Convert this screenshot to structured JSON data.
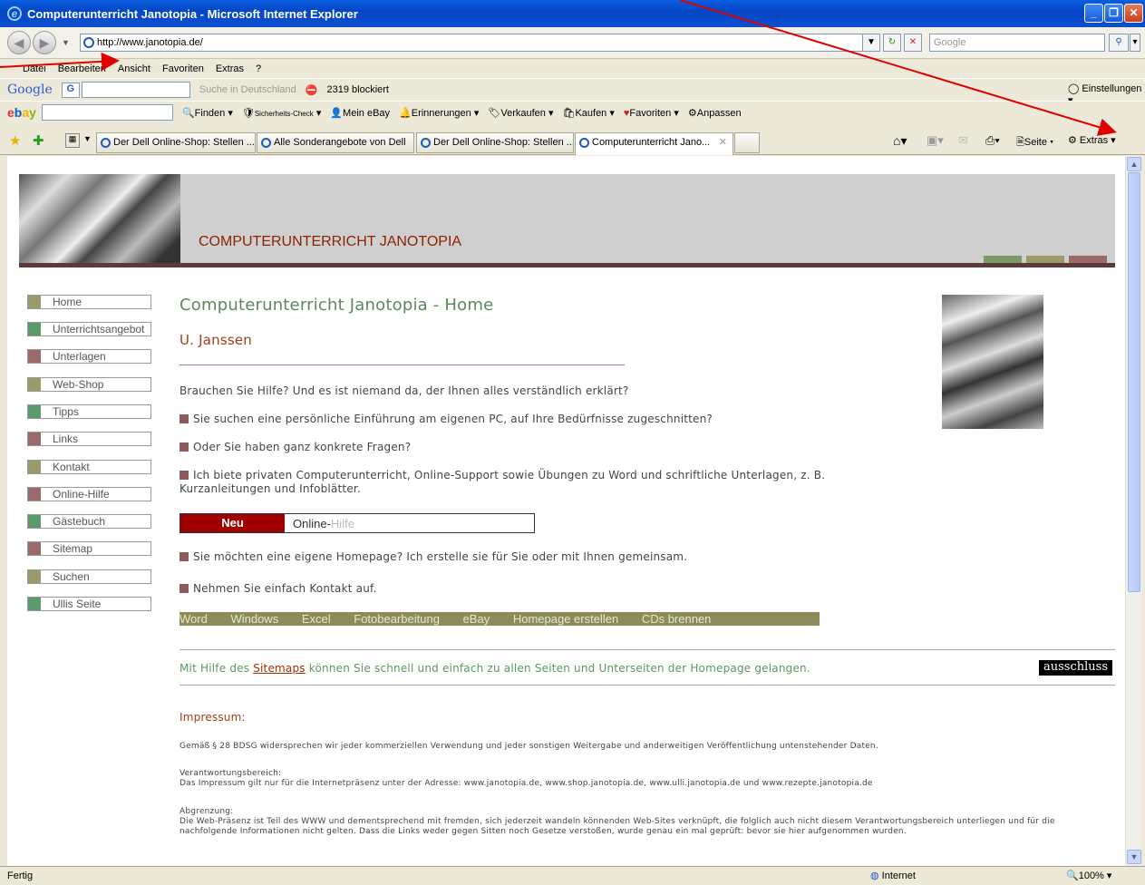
{
  "window": {
    "title": "Computerunterricht Janotopia - Microsoft Internet Explorer"
  },
  "address": {
    "url": "http://www.janotopia.de/",
    "search_placeholder": "Google"
  },
  "menu": [
    "Datei",
    "Bearbeiten",
    "Ansicht",
    "Favoriten",
    "Extras",
    "?"
  ],
  "google_toolbar": {
    "brand": "Google",
    "search_hint": "Suche in Deutschland",
    "blocked": "2319 blockiert",
    "settings": "Einstellungen"
  },
  "ebay_toolbar": {
    "items": [
      "Finden",
      "Sicherheits-Check",
      "Mein eBay",
      "Erinnerungen",
      "Verkaufen",
      "Kaufen",
      "Favoriten",
      "Anpassen"
    ]
  },
  "tabs": [
    "Der Dell Online-Shop: Stellen ...",
    "Alle Sonderangebote von Dell",
    "Der Dell Online-Shop: Stellen ...",
    "Computerunterricht Jano..."
  ],
  "command_bar": {
    "page": "Seite",
    "tools": "Extras"
  },
  "page": {
    "header_title": "COMPUTERUNTERRICHT JANOTOPIA",
    "nav": [
      "Home",
      "Unterrichtsangebot",
      "Unterlagen",
      "Web-Shop",
      "Tipps",
      "Links",
      "Kontakt",
      "Online-Hilfe",
      "Gästebuch",
      "Sitemap",
      "Suchen",
      "Ullis Seite"
    ],
    "heading": "Computerunterricht Janotopia - Home",
    "author": "U. Janssen",
    "intro": "Brauchen Sie Hilfe? Und es ist niemand da, der Ihnen alles verständlich erklärt?",
    "b1": "Sie suchen eine persönliche Einführung am eigenen PC, auf Ihre Bedürfnisse zugeschnitten?",
    "b2": "Oder Sie haben ganz konkrete Fragen?",
    "b3": "Ich biete privaten Computerunterricht, Online-Support sowie Übungen zu Word und schriftliche Unterlagen, z. B. Kurzanleitungen und Infoblätter.",
    "new_label": "Neu",
    "new_text_a": "Online-",
    "new_text_b": "Hilfe",
    "b4": "Sie möchten eine eigene Homepage? Ich erstelle sie für Sie oder mit Ihnen gemeinsam.",
    "b5": "Nehmen Sie einfach Kontakt auf.",
    "topics": [
      "Word",
      "Windows",
      "Excel",
      "Fotobearbeitung",
      "eBay",
      "Homepage erstellen",
      "CDs brennen"
    ],
    "sitemap_pre": "Mit Hilfe des ",
    "sitemap_link": "Sitemaps",
    "sitemap_post": " können Sie schnell und einfach zu allen Seiten und Unterseiten der Homepage gelangen.",
    "badge": "ausschluss",
    "impressum_title": "Impressum:",
    "imp1": "Gemäß § 28 BDSG widersprechen wir jeder kommerziellen Verwendung und jeder sonstigen Weitergabe und anderweitigen Veröffentlichung untenstehender Daten.",
    "imp2a": "Verantwortungsbereich:",
    "imp2b": "Das Impressum gilt nur für die Internetpräsenz unter der Adresse: www.janotopia.de, www.shop.janotopia.de, www.ulli.janotopia.de und www.rezepte.janotopia.de",
    "imp3a": "Abgrenzung:",
    "imp3b": "Die Web-Präsenz ist Teil des WWW und dementsprechend mit fremden, sich jederzeit wandeln könnenden Web-Sites verknüpft, die folglich auch nicht diesem Verantwortungsbereich unterliegen und für die nachfolgende Informationen nicht gelten. Dass die Links weder gegen Sitten noch Gesetze verstoßen, wurde genau ein mal geprüft: bevor sie hier aufgenommen wurden."
  },
  "status": {
    "text": "Fertig",
    "zone": "Internet",
    "zoom": "100%"
  },
  "colors": {
    "olive": "#9a9a6a",
    "green": "#6a9a6a",
    "rose": "#9a6a6a",
    "heading": "#5a8a5a",
    "rust": "#a0401a"
  }
}
